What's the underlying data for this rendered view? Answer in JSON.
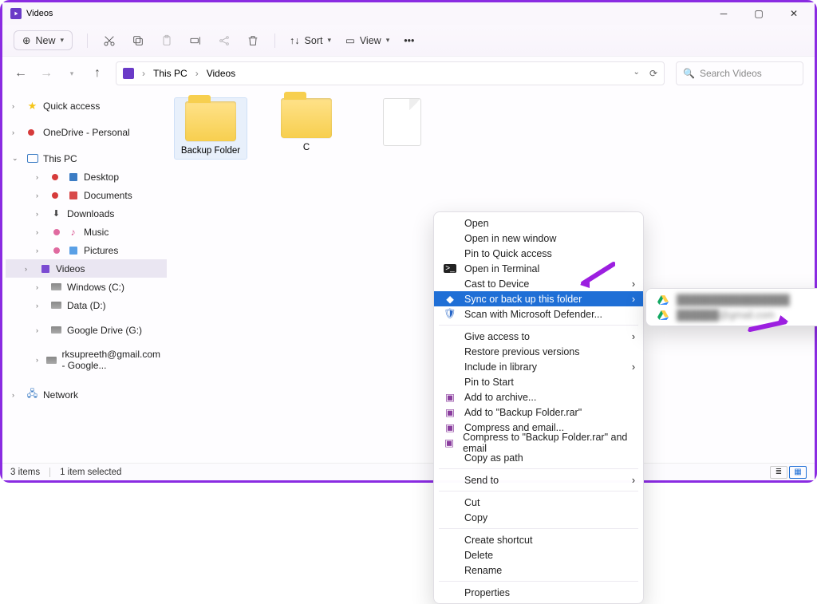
{
  "window": {
    "title": "Videos"
  },
  "toolbar": {
    "new_label": "New",
    "sort_label": "Sort",
    "view_label": "View"
  },
  "breadcrumb": {
    "root": "This PC",
    "leaf": "Videos"
  },
  "search": {
    "placeholder": "Search Videos"
  },
  "sidebar": {
    "quick_access": "Quick access",
    "onedrive": "OneDrive - Personal",
    "this_pc": "This PC",
    "desktop": "Desktop",
    "documents": "Documents",
    "downloads": "Downloads",
    "music": "Music",
    "pictures": "Pictures",
    "videos": "Videos",
    "windows_c": "Windows (C:)",
    "data_d": "Data (D:)",
    "gdrive_g": "Google Drive (G:)",
    "gmail_drive": "rksupreeth@gmail.com - Google...",
    "network": "Network"
  },
  "items": {
    "backup_folder": "Backup Folder",
    "captures": "C"
  },
  "context_menu": {
    "open": "Open",
    "open_new_window": "Open in new window",
    "pin_quick": "Pin to Quick access",
    "open_terminal": "Open in Terminal",
    "cast": "Cast to Device",
    "sync_backup": "Sync or back up this folder",
    "defender": "Scan with Microsoft Defender...",
    "give_access": "Give access to",
    "restore_prev": "Restore previous versions",
    "include_library": "Include in library",
    "pin_start": "Pin to Start",
    "add_archive": "Add to archive...",
    "add_to_rar": "Add to \"Backup Folder.rar\"",
    "compress_email": "Compress and email...",
    "compress_to_rar_email": "Compress to \"Backup Folder.rar\" and email",
    "copy_as_path": "Copy as path",
    "send_to": "Send to",
    "cut": "Cut",
    "copy": "Copy",
    "create_shortcut": "Create shortcut",
    "delete": "Delete",
    "rename": "Rename",
    "properties": "Properties"
  },
  "submenu": {
    "account1": "████████████████",
    "account2": "██████@gmail.com"
  },
  "statusbar": {
    "item_count": "3 items",
    "selection": "1 item selected"
  }
}
